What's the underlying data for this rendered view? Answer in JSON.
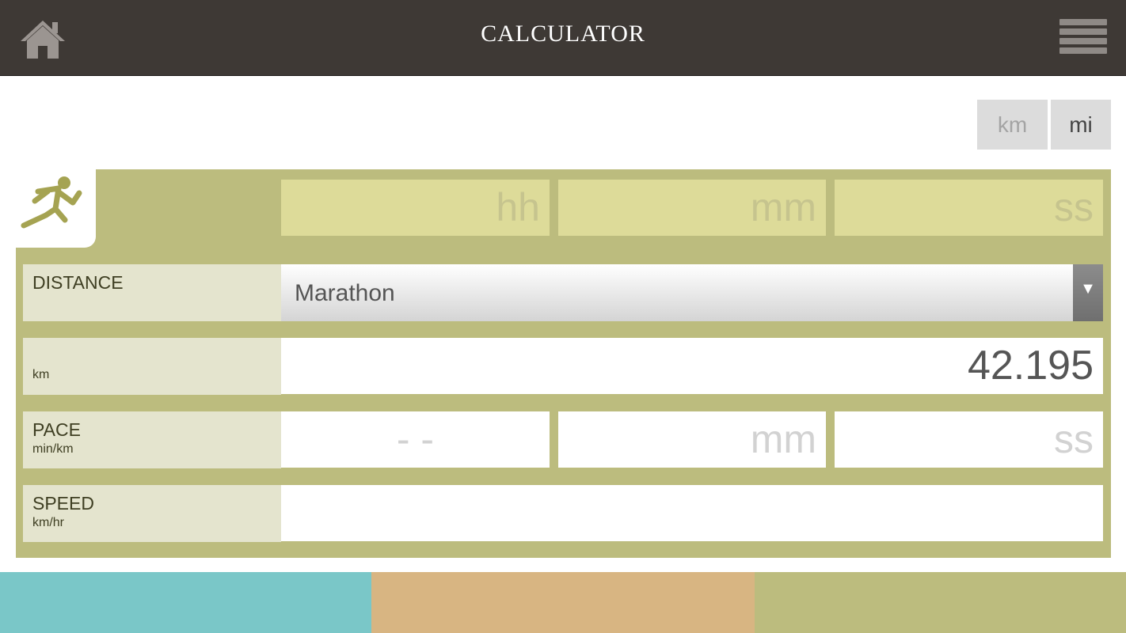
{
  "header": {
    "title": "CALCULATOR",
    "home_icon": "home-icon",
    "menu_icon": "hamburger-menu-icon"
  },
  "units": {
    "km_label": "km",
    "mi_label": "mi"
  },
  "time": {
    "hh_placeholder": "hh",
    "mm_placeholder": "mm",
    "ss_placeholder": "ss"
  },
  "distance": {
    "label": "DISTANCE",
    "selected": "Marathon",
    "value": "42.195",
    "unit": "km"
  },
  "pace": {
    "label": "PACE",
    "unit": "min/km",
    "mm_placeholder": "- -",
    "ss_placeholder": "mm",
    "extra_placeholder": "ss"
  },
  "speed": {
    "label": "SPEED",
    "unit": "km/hr",
    "value": ""
  },
  "colors": {
    "header_bg": "#3e3935",
    "panel_bg": "#bcbc7e",
    "tab_teal": "#7ac7c8",
    "tab_tan": "#d8b582",
    "tab_olive": "#bcbc7e"
  }
}
